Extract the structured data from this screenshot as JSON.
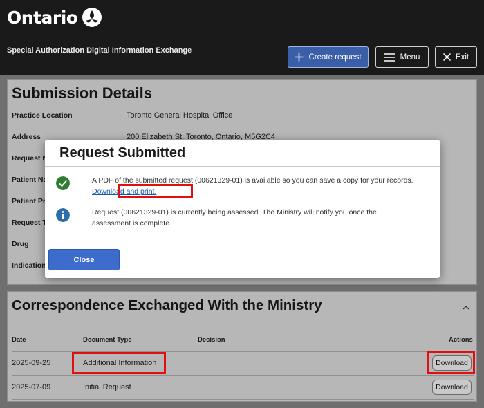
{
  "brand": {
    "name": "Ontario"
  },
  "header": {
    "app_title": "Special Authorization Digital Information Exchange",
    "create_label": "Create request",
    "menu_label": "Menu",
    "exit_label": "Exit"
  },
  "submission": {
    "title": "Submission Details",
    "rows": [
      {
        "label": "Practice Location",
        "value": "Toronto General Hospital Office"
      },
      {
        "label": "Address",
        "value": "200 Elizabeth St. Toronto, Ontario, M5G2C4"
      },
      {
        "label": "Request N",
        "value": ""
      },
      {
        "label": "Patient Na",
        "value": ""
      },
      {
        "label": "Patient Pr",
        "value": ""
      },
      {
        "label": "Request T",
        "value": ""
      },
      {
        "label": "Drug",
        "value": ""
      },
      {
        "label": "Indication",
        "value": ""
      }
    ]
  },
  "correspondence": {
    "title": "Correspondence Exchanged With the Ministry",
    "columns": {
      "date": "Date",
      "doc_type": "Document Type",
      "decision": "Decision",
      "actions": "Actions"
    },
    "rows": [
      {
        "date": "2025-09-25",
        "doc_type": "Additional Information",
        "decision": "",
        "action": "Download"
      },
      {
        "date": "2025-07-09",
        "doc_type": "Initial Request",
        "decision": "",
        "action": "Download"
      }
    ]
  },
  "modal": {
    "title": "Request Submitted",
    "message1_part1": "A PDF of the submitted request (00621329-01) is available so you can save a copy for your",
    "message1_part2": "records.",
    "message1_link": "Download and print.",
    "message2": "Request (00621329-01) is currently being assessed. The Ministry will notify you once the assessment is complete.",
    "close_label": "Close"
  },
  "colors": {
    "header_bg": "#1a1a1a",
    "primary_blue": "#3d6ccc",
    "success_green": "#2e7d32",
    "info_blue": "#2c6fa8",
    "highlight_red": "#e01010"
  },
  "icons": {
    "logo": "trillium-logo-icon",
    "create": "plus-icon",
    "menu": "hamburger-icon",
    "exit": "close-icon",
    "collapse": "chevron-up-icon",
    "success": "check-circle-icon",
    "info": "info-circle-icon"
  }
}
